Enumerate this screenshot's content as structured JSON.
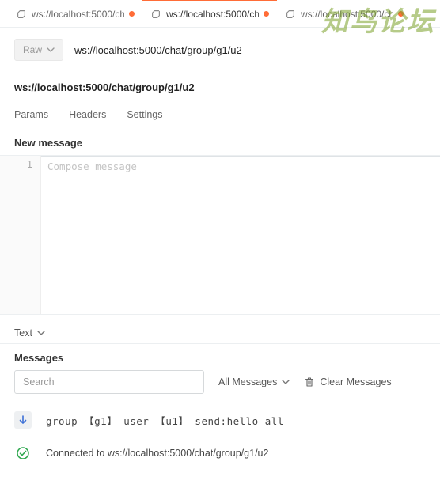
{
  "watermark": "知鸟论坛",
  "tabs": [
    {
      "label": "ws://localhost:5000/ch",
      "active": false,
      "dirty": true
    },
    {
      "label": "ws://localhost:5000/ch",
      "active": true,
      "dirty": true
    },
    {
      "label": "ws://localhost:5000/ch",
      "active": false,
      "dirty": true
    }
  ],
  "method": {
    "label": "Raw"
  },
  "url": "ws://localhost:5000/chat/group/g1/u2",
  "url_echo": "ws://localhost:5000/chat/group/g1/u2",
  "subtabs": {
    "params": "Params",
    "headers": "Headers",
    "settings": "Settings"
  },
  "compose": {
    "title": "New message",
    "line_no": "1",
    "placeholder": "Compose message"
  },
  "body_type": "Text",
  "messages": {
    "title": "Messages",
    "search_placeholder": "Search",
    "filter_label": "All Messages",
    "clear_label": "Clear Messages",
    "items": [
      {
        "kind": "incoming",
        "text": "group 【g1】 user 【u1】 send:hello all"
      },
      {
        "kind": "status",
        "text": "Connected to ws://localhost:5000/chat/group/g1/u2"
      }
    ]
  }
}
